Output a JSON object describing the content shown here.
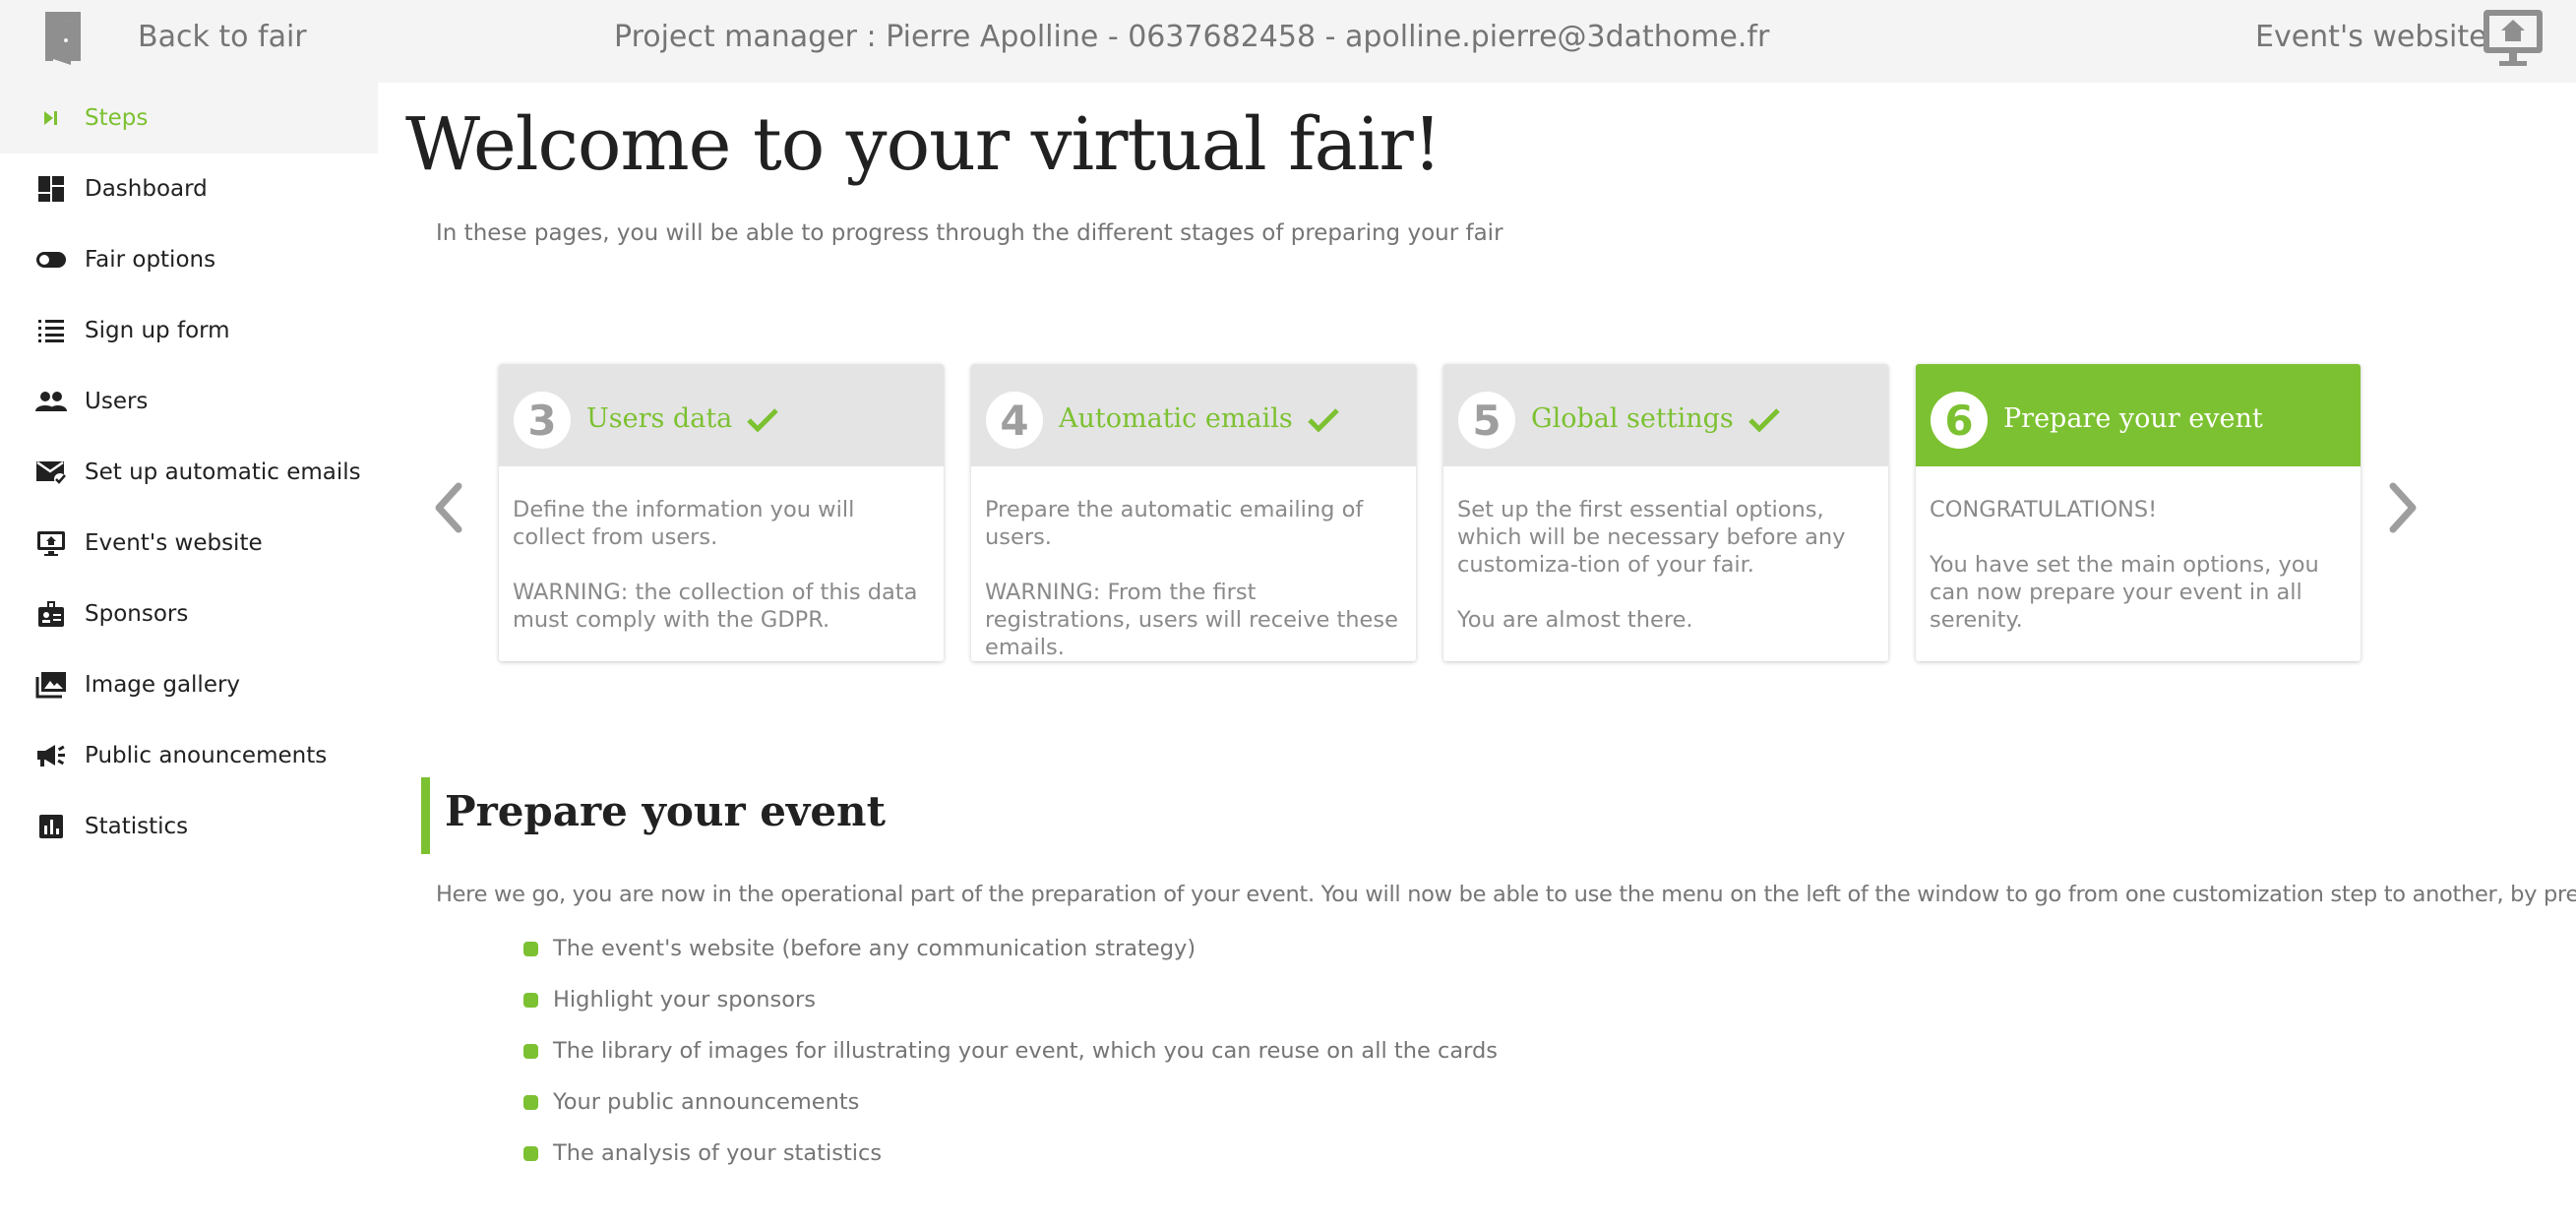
{
  "header": {
    "back_label": "Back to fair",
    "project_manager": "Project manager : Pierre Apolline - 0637682458 - apolline.pierre@3dathome.fr",
    "website_label": "Event's website",
    "back_icon": "door-exit-icon",
    "website_icon": "monitor-home-icon"
  },
  "sidebar": {
    "items": [
      {
        "label": "Steps",
        "icon": "skip-next-icon",
        "active": true
      },
      {
        "label": "Dashboard",
        "icon": "dashboard-icon"
      },
      {
        "label": "Fair options",
        "icon": "toggle-icon"
      },
      {
        "label": "Sign up form",
        "icon": "list-icon"
      },
      {
        "label": "Users",
        "icon": "people-icon"
      },
      {
        "label": "Set up automatic emails",
        "icon": "mail-check-icon"
      },
      {
        "label": "Event's website",
        "icon": "monitor-icon"
      },
      {
        "label": "Sponsors",
        "icon": "badge-icon"
      },
      {
        "label": "Image gallery",
        "icon": "photo-library-icon"
      },
      {
        "label": "Public anouncements",
        "icon": "megaphone-icon"
      },
      {
        "label": "Statistics",
        "icon": "bar-chart-icon"
      }
    ]
  },
  "main": {
    "title": "Welcome to your virtual fair!",
    "subtitle": "In these pages, you will be able to progress through the different stages of preparing your fair",
    "steps": [
      {
        "number": "3",
        "title": "Users data",
        "done": true,
        "paragraphs": [
          "Define the information you will collect from users.",
          "WARNING: the collection of this data must comply with the GDPR."
        ]
      },
      {
        "number": "4",
        "title": "Automatic emails",
        "done": true,
        "paragraphs": [
          "Prepare the automatic emailing of users.",
          "WARNING: From the first registrations, users will receive these emails."
        ]
      },
      {
        "number": "5",
        "title": "Global settings",
        "done": true,
        "paragraphs": [
          "Set up the first essential options, which will be necessary before any customiza-tion of your fair.",
          "You are almost there."
        ]
      },
      {
        "number": "6",
        "title": "Prepare your event",
        "done": false,
        "current": true,
        "paragraphs": [
          "CONGRATULATIONS!",
          "You have set the main options, you can now prepare your event in all serenity."
        ]
      }
    ],
    "section": {
      "title": "Prepare your event",
      "intro": "Here we go, you are now in the operational part of the preparation of your event. You will now be able to use the menu on the left of the window to go from one customization step to another, by preparing:",
      "items": [
        "The event's website (before any communication strategy)",
        "Highlight your sponsors",
        "The library of images for illustrating your event, which you can reuse on all the cards",
        "Your public announcements",
        "The analysis of your statistics"
      ]
    }
  },
  "colors": {
    "accent": "#7cc131",
    "header_bg": "#f4f4f4",
    "card_head_bg": "#e4e4e4"
  }
}
